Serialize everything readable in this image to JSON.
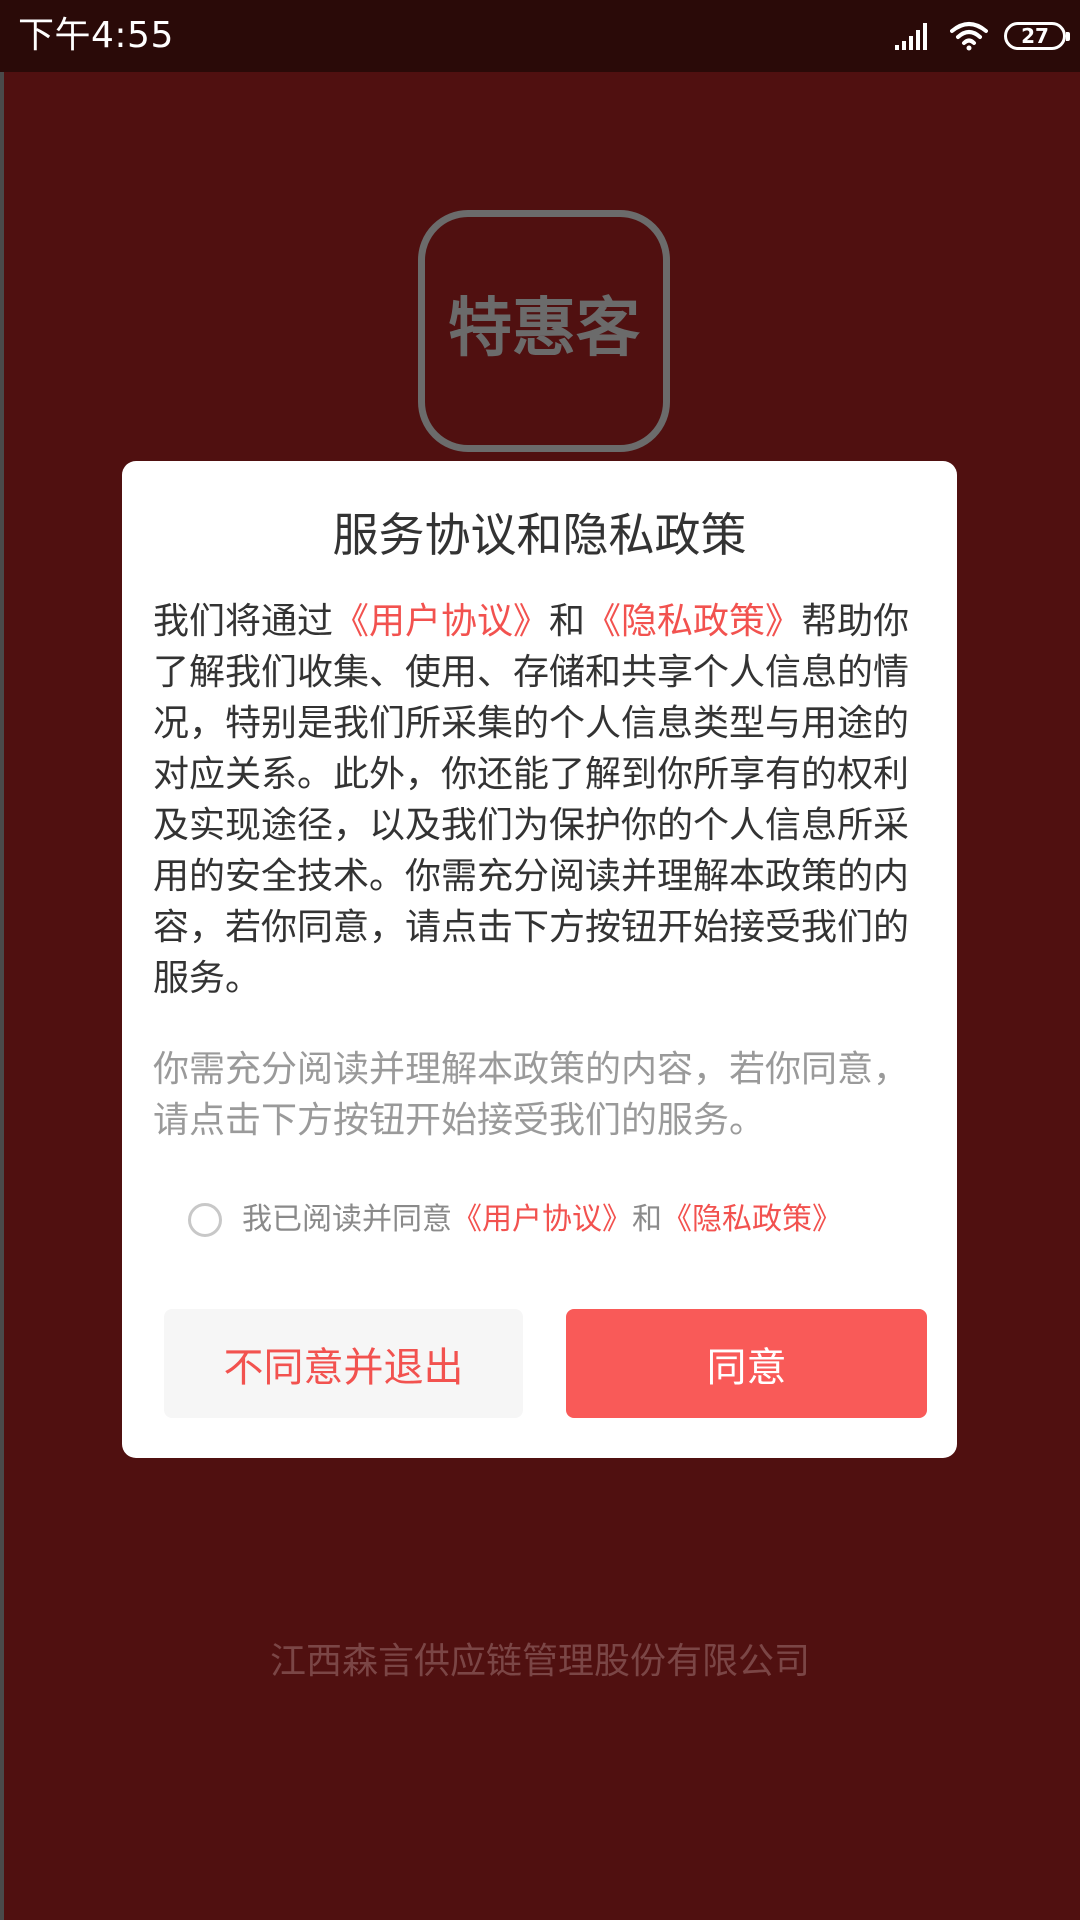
{
  "status_bar": {
    "time": "下午4:55",
    "battery": "27",
    "icons": [
      "signal-icon",
      "wifi-icon",
      "battery-icon"
    ]
  },
  "splash": {
    "logo_text": "特惠客",
    "company": "江西森言供应链管理股份有限公司"
  },
  "dialog": {
    "title": "服务协议和隐私政策",
    "body": {
      "prefix": "我们将通过",
      "link_user_agreement": "《用户协议》",
      "and": "和",
      "link_privacy_policy": "《隐私政策》",
      "rest": "帮助你了解我们收集、使用、存储和共享个人信息的情况，特别是我们所采集的个人信息类型与用途的对应关系。此外，你还能了解到你所享有的权利及实现途径，以及我们为保护你的个人信息所采用的安全技术。你需充分阅读并理解本政策的内容，若你同意，请点击下方按钮开始接受我们的服务。"
    },
    "note": "你需充分阅读并理解本政策的内容，若你同意，请点击下方按钮开始接受我们的服务。",
    "agree_checkbox": {
      "checked": false,
      "text": "我已阅读并同意",
      "link_user_agreement": "《用户协议》",
      "and": "和",
      "link_privacy_policy": "《隐私政策》"
    },
    "buttons": {
      "decline": "不同意并退出",
      "agree": "同意"
    }
  },
  "colors": {
    "background": "#501010",
    "accent": "#f95a58",
    "link": "#f2524f"
  }
}
